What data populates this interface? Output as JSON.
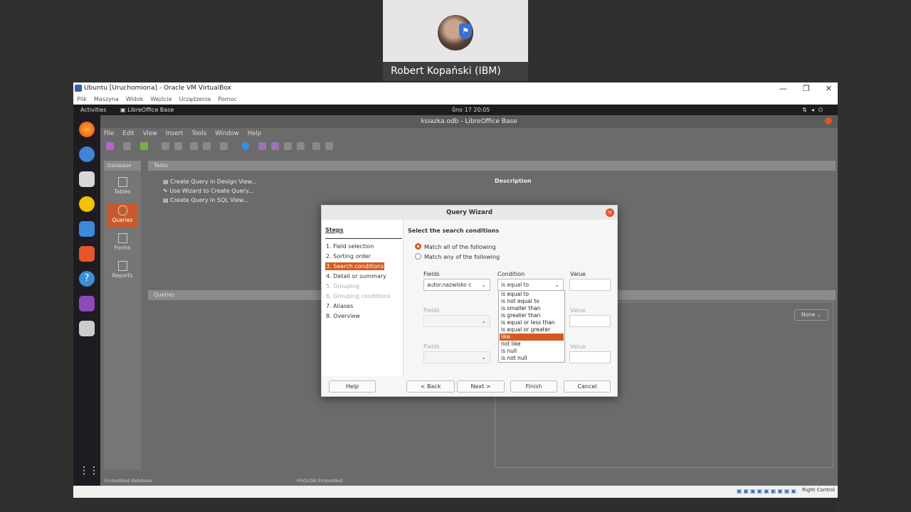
{
  "participant": {
    "name": "Robert Kopański (IBM)"
  },
  "vbox": {
    "title": "Ubuntu [Uruchomiona] - Oracle VM VirtualBox",
    "menu": [
      "Plik",
      "Maszyna",
      "Widok",
      "Wejście",
      "Urządzenia",
      "Pomoc"
    ],
    "host_key": "Right Control"
  },
  "ubuntu": {
    "activities": "Activities",
    "app_name": "LibreOffice Base",
    "clock": "ůno 17 20:05"
  },
  "lo": {
    "title": "ksiazka.odb - LibreOffice Base",
    "menu": [
      "File",
      "Edit",
      "View",
      "Insert",
      "Tools",
      "Window",
      "Help"
    ],
    "database_header": "Database",
    "db_items": [
      "Tables",
      "Queries",
      "Forms",
      "Reports"
    ],
    "tasks_header": "Tasks",
    "tasks": [
      "Create Query in Design View...",
      "Use Wizard to Create Query...",
      "Create Query in SQL View..."
    ],
    "description_label": "Description",
    "queries_header": "Queries",
    "none_button": "None",
    "status_left": "Embedded database",
    "status_mid": "HSQLDB Embedded"
  },
  "wizard": {
    "title": "Query Wizard",
    "steps_header": "Steps",
    "steps": [
      "1. Field selection",
      "2. Sorting order",
      "3. Search conditions",
      "4. Detail or summary",
      "5. Grouping",
      "6. Grouping conditions",
      "7. Aliases",
      "8. Overview"
    ],
    "section_title": "Select the search conditions",
    "match_all": "Match all of the following",
    "match_any": "Match any of the following",
    "fields_label": "Fields",
    "condition_label": "Condition",
    "value_label": "Value",
    "field1_value": "autor.nazwisko c",
    "condition1_value": "is equal to",
    "condition_options": [
      "is equal to",
      "is not equal to",
      "is smaller than",
      "is greater than",
      "is equal or less than",
      "is equal or greater than",
      "like",
      "not like",
      "is null",
      "is not null"
    ],
    "buttons": {
      "help": "Help",
      "back": "< Back",
      "next": "Next >",
      "finish": "Finish",
      "cancel": "Cancel"
    }
  },
  "colors": {
    "accent": "#d35b22",
    "dock_bg": "#1f1b22"
  }
}
